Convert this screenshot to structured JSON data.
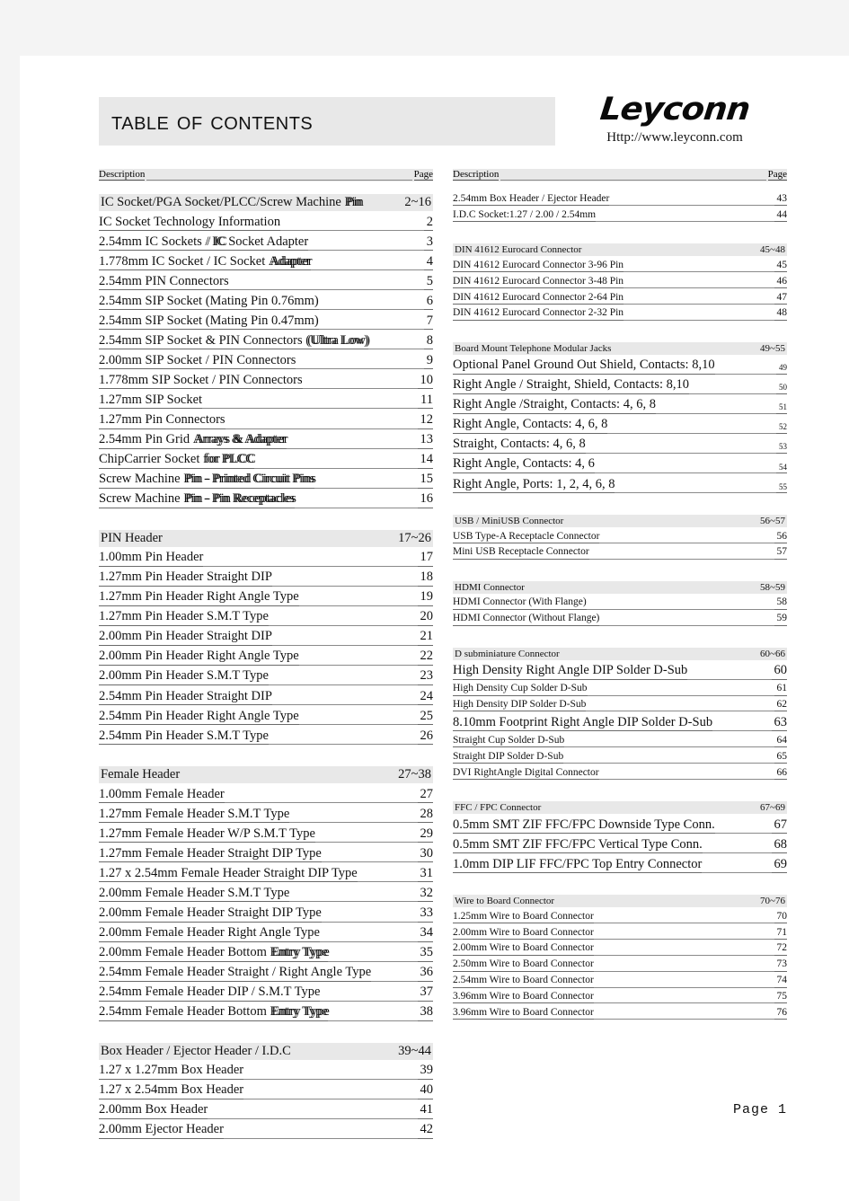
{
  "document": {
    "title": "Table Of Contents",
    "footer_page_label": "Page  1"
  },
  "brand": {
    "logo_text": "Leyconn",
    "url": "Http://www.leyconn.com"
  },
  "columns": {
    "header": {
      "description_label": "Description",
      "page_label": "Page"
    },
    "left": [
      {
        "type": "group",
        "label": "IC Socket/PGA Socket/PLCC/Screw Machine",
        "overlap": "Pin",
        "page": "2~16",
        "size": "normal"
      },
      {
        "type": "entry",
        "label": "IC  Socket  Technology  Information",
        "page": "2",
        "size": "normal"
      },
      {
        "type": "entry",
        "label": "2.54mm  IC  Sockets",
        "overlap": "/ IC",
        "label2": "Socket  Adapter",
        "page": "3",
        "size": "normal"
      },
      {
        "type": "entry",
        "label": "1.778mm  IC  Socket  /  IC  Socket",
        "overlap": "Adapter",
        "page": "4",
        "size": "normal"
      },
      {
        "type": "entry",
        "label": "2.54mm  PIN  Connectors",
        "page": "5",
        "size": "normal"
      },
      {
        "type": "entry",
        "label": "2.54mm  SIP  Socket  (Mating  Pin  0.76mm)",
        "page": "6",
        "size": "normal"
      },
      {
        "type": "entry",
        "label": "2.54mm  SIP  Socket  (Mating  Pin  0.47mm)",
        "page": "7",
        "size": "normal"
      },
      {
        "type": "entry",
        "label": "2.54mm  SIP  Socket  &  PIN  Connectors",
        "overlap": "(Ultra Low)",
        "page": "8",
        "size": "normal"
      },
      {
        "type": "entry",
        "label": "2.00mm  SIP  Socket  /  PIN  Connectors",
        "page": "9",
        "size": "normal"
      },
      {
        "type": "entry",
        "label": "1.778mm  SIP  Socket  /  PIN  Connectors",
        "page": "10",
        "size": "normal"
      },
      {
        "type": "entry",
        "label": "1.27mm  SIP  Socket",
        "page": "11",
        "size": "normal"
      },
      {
        "type": "entry",
        "label": "1.27mm  Pin  Connectors",
        "page": "12",
        "size": "normal"
      },
      {
        "type": "entry",
        "label": "2.54mm  Pin  Grid",
        "overlap": "Arrays  &  Adapter",
        "page": "13",
        "size": "normal"
      },
      {
        "type": "entry",
        "label": "ChipCarrier  Socket",
        "overlap": "for  PLCC",
        "page": "14",
        "size": "normal"
      },
      {
        "type": "entry",
        "label": "Screw  Machine",
        "overlap": "Pin  -  Printed  Circuit  Pins",
        "page": "15",
        "size": "normal"
      },
      {
        "type": "entry",
        "label": "Screw  Machine",
        "overlap": "Pin  -  Pin  Receptacles",
        "page": "16",
        "size": "normal"
      },
      {
        "type": "spacer"
      },
      {
        "type": "group",
        "label": "PIN  Header",
        "page": "17~26",
        "size": "normal"
      },
      {
        "type": "entry",
        "label": "1.00mm  Pin  Header",
        "page": "17",
        "size": "normal"
      },
      {
        "type": "entry",
        "label": "1.27mm  Pin  Header  Straight  DIP",
        "page": "18",
        "size": "normal"
      },
      {
        "type": "entry",
        "label": "1.27mm  Pin  Header  Right  Angle  Type",
        "page": "19",
        "size": "normal"
      },
      {
        "type": "entry",
        "label": "1.27mm  Pin  Header  S.M.T  Type",
        "page": "20",
        "size": "normal"
      },
      {
        "type": "entry",
        "label": "2.00mm  Pin  Header  Straight  DIP",
        "page": "21",
        "size": "normal"
      },
      {
        "type": "entry",
        "label": "2.00mm  Pin  Header  Right  Angle  Type",
        "page": "22",
        "size": "normal"
      },
      {
        "type": "entry",
        "label": "2.00mm  Pin  Header  S.M.T  Type",
        "page": "23",
        "size": "normal"
      },
      {
        "type": "entry",
        "label": "2.54mm  Pin  Header  Straight  DIP",
        "page": "24",
        "size": "normal"
      },
      {
        "type": "entry",
        "label": "2.54mm  Pin  Header  Right  Angle  Type",
        "page": "25",
        "size": "normal"
      },
      {
        "type": "entry",
        "label": "2.54mm  Pin  Header  S.M.T  Type",
        "page": "26",
        "size": "normal"
      },
      {
        "type": "spacer"
      },
      {
        "type": "group",
        "label": "Female  Header",
        "page": "27~38",
        "size": "normal"
      },
      {
        "type": "entry",
        "label": "1.00mm  Female  Header",
        "page": "27",
        "size": "normal"
      },
      {
        "type": "entry",
        "label": "1.27mm  Female  Header  S.M.T  Type",
        "page": "28",
        "size": "normal"
      },
      {
        "type": "entry",
        "label": "1.27mm  Female  Header  W/P  S.M.T  Type",
        "page": "29",
        "size": "normal"
      },
      {
        "type": "entry",
        "label": "1.27mm  Female  Header  Straight  DIP  Type",
        "page": "30",
        "size": "normal"
      },
      {
        "type": "entry",
        "label": "1.27  x  2.54mm  Female  Header  Straight  DIP  Type",
        "page": "31",
        "size": "normal"
      },
      {
        "type": "entry",
        "label": "2.00mm  Female  Header  S.M.T  Type",
        "page": "32",
        "size": "normal"
      },
      {
        "type": "entry",
        "label": "2.00mm  Female  Header  Straight  DIP  Type",
        "page": "33",
        "size": "normal"
      },
      {
        "type": "entry",
        "label": "2.00mm  Female  Header  Right  Angle  Type",
        "page": "34",
        "size": "normal"
      },
      {
        "type": "entry",
        "label": "2.00mm  Female  Header  Bottom",
        "overlap": "Entry  Type",
        "page": "35",
        "size": "normal"
      },
      {
        "type": "entry",
        "label": "2.54mm  Female  Header  Straight  /  Right  Angle  Type",
        "page": "36",
        "size": "normal"
      },
      {
        "type": "entry",
        "label": "2.54mm  Female  Header  DIP  /  S.M.T  Type",
        "page": "37",
        "size": "normal"
      },
      {
        "type": "entry",
        "label": "2.54mm  Female  Header  Bottom",
        "overlap": "Entry  Type",
        "page": "38",
        "size": "normal"
      },
      {
        "type": "spacer"
      },
      {
        "type": "group",
        "label": "Box  Header  /  Ejector  Header  /  I.D.C",
        "page": "39~44",
        "size": "normal"
      },
      {
        "type": "entry",
        "label": "1.27  x  1.27mm  Box  Header",
        "page": "39",
        "size": "normal"
      },
      {
        "type": "entry",
        "label": "1.27  x  2.54mm  Box  Header",
        "page": "40",
        "size": "normal"
      },
      {
        "type": "entry",
        "label": "2.00mm  Box  Header",
        "page": "41",
        "size": "normal"
      },
      {
        "type": "entry",
        "label": "2.00mm  Ejector  Header",
        "page": "42",
        "size": "normal"
      }
    ],
    "right": [
      {
        "type": "entry",
        "label": "2.54mm  Box  Header  /  Ejector  Header",
        "page": "43",
        "size": "small"
      },
      {
        "type": "entry",
        "label": "I.D.C  Socket:1.27  /  2.00  /  2.54mm",
        "page": "44",
        "size": "small"
      },
      {
        "type": "spacer"
      },
      {
        "type": "group",
        "label": "DIN  41612  Eurocard  Connector",
        "page": "45~48",
        "size": "small"
      },
      {
        "type": "entry",
        "label": "DIN  41612  Eurocard  Connector  3-96  Pin",
        "page": "45",
        "size": "small"
      },
      {
        "type": "entry",
        "label": "DIN  41612  Eurocard  Connector  3-48  Pin",
        "page": "46",
        "size": "small"
      },
      {
        "type": "entry",
        "label": "DIN  41612  Eurocard  Connector  2-64  Pin",
        "page": "47",
        "size": "small"
      },
      {
        "type": "entry",
        "label": "DIN  41612  Eurocard  Connector  2-32  Pin",
        "page": "48",
        "size": "small"
      },
      {
        "type": "spacer"
      },
      {
        "type": "group",
        "label": "Board  Mount  Telephone  Modular  Jacks",
        "page": "49~55",
        "size": "small"
      },
      {
        "type": "entry",
        "label": "Optional  Panel  Ground  Out  Shield,  Contacts:  8,10",
        "page": "49",
        "size": "normal",
        "page_size": "tiny"
      },
      {
        "type": "entry",
        "label": "Right  Angle  /  Straight,    Shield,  Contacts:  8,10",
        "page": "50",
        "size": "normal",
        "page_size": "tiny"
      },
      {
        "type": "entry",
        "label": "Right  Angle  /Straight,    Contacts:  4,  6,  8",
        "page": "51",
        "size": "normal",
        "page_size": "tiny"
      },
      {
        "type": "entry",
        "label": "Right  Angle,    Contacts:  4,  6,  8",
        "page": "52",
        "size": "normal",
        "page_size": "tiny"
      },
      {
        "type": "entry",
        "label": "Straight,  Contacts:  4,  6,  8",
        "page": "53",
        "size": "normal",
        "page_size": "tiny"
      },
      {
        "type": "entry",
        "label": "Right  Angle,    Contacts:  4,  6",
        "page": "54",
        "size": "normal",
        "page_size": "tiny"
      },
      {
        "type": "entry",
        "label": "Right  Angle,    Ports:  1,  2,  4,  6,  8",
        "page": "55",
        "size": "normal",
        "page_size": "tiny"
      },
      {
        "type": "spacer"
      },
      {
        "type": "group",
        "label": "USB  /  MiniUSB  Connector",
        "page": "56~57",
        "size": "small"
      },
      {
        "type": "entry",
        "label": "USB  Type-A  Receptacle  Connector",
        "page": "56",
        "size": "small"
      },
      {
        "type": "entry",
        "label": "Mini USB   Receptacle  Connector",
        "page": "57",
        "size": "small"
      },
      {
        "type": "spacer"
      },
      {
        "type": "group",
        "label": "HDMI  Connector",
        "page": "58~59",
        "size": "small"
      },
      {
        "type": "entry",
        "label": "HDMI  Connector  (With  Flange)",
        "page": "58",
        "size": "small"
      },
      {
        "type": "entry",
        "label": "HDMI  Connector  (Without  Flange)",
        "page": "59",
        "size": "small"
      },
      {
        "type": "spacer"
      },
      {
        "type": "group",
        "label": "D  subminiature  Connector",
        "page": "60~66",
        "size": "small"
      },
      {
        "type": "entry",
        "label": "High  Density  Right  Angle  DIP  Solder  D-Sub",
        "page": "60",
        "size": "normal"
      },
      {
        "type": "entry",
        "label": "High  Density  Cup  Solder  D-Sub",
        "page": "61",
        "size": "small"
      },
      {
        "type": "entry",
        "label": "High  Density  DIP  Solder  D-Sub",
        "page": "62",
        "size": "small"
      },
      {
        "type": "entry",
        "label": "8.10mm  Footprint  Right  Angle  DIP  Solder  D-Sub",
        "page": "63",
        "size": "normal"
      },
      {
        "type": "entry",
        "label": "Straight  Cup  Solder  D-Sub",
        "page": "64",
        "size": "small"
      },
      {
        "type": "entry",
        "label": "Straight  DIP  Solder  D-Sub",
        "page": "65",
        "size": "small"
      },
      {
        "type": "entry",
        "label": "DVI  RightAngle  Digital  Connector",
        "page": "66",
        "size": "small"
      },
      {
        "type": "spacer"
      },
      {
        "type": "group",
        "label": "FFC  /  FPC  Connector",
        "page": "67~69",
        "size": "small"
      },
      {
        "type": "entry",
        "label": "0.5mm  SMT  ZIF  FFC/FPC  Downside  Type  Conn.",
        "page": "67",
        "size": "normal"
      },
      {
        "type": "entry",
        "label": "0.5mm  SMT  ZIF  FFC/FPC  Vertical  Type  Conn.",
        "page": "68",
        "size": "normal"
      },
      {
        "type": "entry",
        "label": "1.0mm  DIP  LIF  FFC/FPC  Top  Entry  Connector",
        "page": "69",
        "size": "normal"
      },
      {
        "type": "spacer"
      },
      {
        "type": "group",
        "label": "Wire to Board   Connector",
        "page": "70~76",
        "size": "small"
      },
      {
        "type": "entry",
        "label": "1.25mm  Wire to Board   Connector",
        "page": "70",
        "size": "small"
      },
      {
        "type": "entry",
        "label": "2.00mm  Wire to Board   Connector",
        "page": "71",
        "size": "small"
      },
      {
        "type": "entry",
        "label": "2.00mm  Wire to Board   Connector",
        "page": "72",
        "size": "small"
      },
      {
        "type": "entry",
        "label": "2.50mm  Wire to Board   Connector",
        "page": "73",
        "size": "small"
      },
      {
        "type": "entry",
        "label": "2.54mm  Wire to Board   Connector",
        "page": "74",
        "size": "small"
      },
      {
        "type": "entry",
        "label": "3.96mm  Wire to Board   Connector",
        "page": "75",
        "size": "small"
      },
      {
        "type": "entry",
        "label": "3.96mm  Wire to Board   Connector",
        "page": "76",
        "size": "small"
      }
    ]
  },
  "colors": {
    "page_background": "#ffffff",
    "outer_background": "#f4f4f4",
    "band_gray": "#e8e8e8",
    "rule_gray": "#8a8a8a",
    "text": "#111111"
  }
}
